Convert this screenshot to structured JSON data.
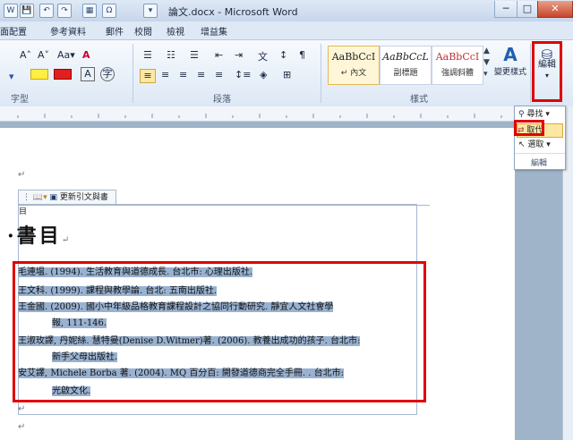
{
  "window": {
    "title": "論文.docx - Microsoft Word"
  },
  "quick_access": [
    "W",
    "💾",
    "↶",
    "↷",
    "▦",
    "Ω",
    "▾"
  ],
  "window_buttons": {
    "minimize": "─",
    "maximize": "□",
    "close": "✕"
  },
  "tabs": [
    "面配置",
    "參考資料",
    "郵件",
    "校閱",
    "檢視",
    "增益集"
  ],
  "ribbon": {
    "font_group_label": "字型",
    "paragraph_group_label": "段落",
    "styles_group_label": "樣式",
    "edit_group_label": "編輯",
    "font_buttons": [
      "A˄",
      "A˅",
      "Aa▾",
      "A"
    ],
    "styles": [
      {
        "sample": "AaBbCcI",
        "name": "↵ 內文"
      },
      {
        "sample": "AaBbCcL",
        "name": "副標題"
      },
      {
        "sample": "AaBbCcI",
        "name": "強調斜體"
      }
    ],
    "change_styles_label": "變更樣式",
    "edit_button_label": "編輯"
  },
  "edit_dropdown": {
    "items": [
      {
        "icon": "find-icon",
        "label": "尋找 ▾"
      },
      {
        "icon": "replace-icon",
        "label": "取代"
      },
      {
        "icon": "select-icon",
        "label": "選取 ▾"
      }
    ],
    "group_label": "編輯"
  },
  "document": {
    "content_control_label": "更新引文與書目",
    "heading": "書目",
    "references": [
      {
        "line1": "毛連塭. (1994). 生活教育與道德成長. 台北市: 心理出版社.",
        "line2": ""
      },
      {
        "line1": "王文科. (1999). 課程與教學論. 台北: 五南出版社.",
        "line2": ""
      },
      {
        "line1": "王金國. (2009). 國小中年級品格教育課程設計之協同行動研究. 靜宜人文社會學",
        "line2": "報, 111-146."
      },
      {
        "line1": "王淑玫譯, 丹妮絲. 慧特曼(Denise D.Witmer)著. (2006). 教養出成功的孩子. 台北市:",
        "line2": "新手父母出版社."
      },
      {
        "line1": "安艾譯, Michele Borba 著. (2004). MQ 百分百: 開發道德商完全手冊. . 台北市:",
        "line2": "光啟文化."
      }
    ],
    "paragraph_mark": "↵"
  }
}
